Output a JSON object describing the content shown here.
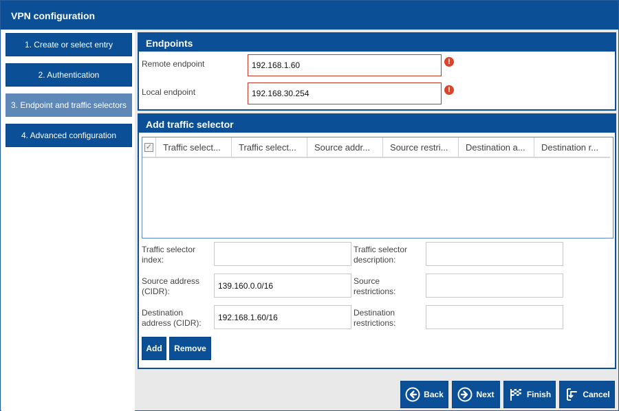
{
  "window": {
    "title": "VPN configuration"
  },
  "sidebar": {
    "items": [
      {
        "label": "1. Create or select entry"
      },
      {
        "label": "2. Authentication"
      },
      {
        "label": "3. Endpoint and traffic selectors"
      },
      {
        "label": "4. Advanced configuration"
      }
    ]
  },
  "endpoints": {
    "title": "Endpoints",
    "remote_label": "Remote endpoint",
    "remote_value": "192.168.1.60",
    "local_label": "Local endpoint",
    "local_value": "192.168.30.254",
    "error_glyph": "!"
  },
  "traffic": {
    "title": "Add traffic selector",
    "columns": [
      "Traffic select...",
      "Traffic select...",
      "Source addr...",
      "Source restri...",
      "Destination a...",
      "Destination r..."
    ],
    "fields": {
      "index_label": "Traffic selector index:",
      "index_value": "",
      "description_label": "Traffic selector description:",
      "description_value": "",
      "source_label": "Source address (CIDR):",
      "source_value": "139.160.0.0/16",
      "source_restr_label": "Source restrictions:",
      "source_restr_value": "",
      "dest_label": "Destination address (CIDR):",
      "dest_value": "192.168.1.60/16",
      "dest_restr_label": "Destination restrictions:",
      "dest_restr_value": ""
    },
    "add_label": "Add",
    "remove_label": "Remove"
  },
  "footer": {
    "back_label": "Back",
    "next_label": "Next",
    "finish_label": "Finish",
    "cancel_label": "Cancel"
  },
  "colors": {
    "primary": "#0b4f96",
    "active_nav": "#5d88b7",
    "error": "#d9462b"
  }
}
